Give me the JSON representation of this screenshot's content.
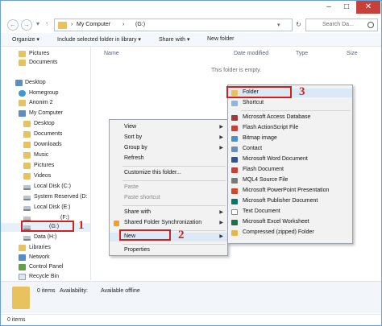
{
  "address": {
    "segments": [
      "My Computer",
      "(G:)"
    ],
    "search_placeholder": "Search Da..."
  },
  "title_controls": {
    "minimize": "–",
    "maximize": "□",
    "close": "✕"
  },
  "nav": {
    "back": "←",
    "forward": "→",
    "up": "↑",
    "recent": "▾",
    "refresh": "↻"
  },
  "toolbar": {
    "organize": "Organize ▾",
    "include": "Include selected folder in library ▾",
    "share": "Share with ▾",
    "new_folder": "New folder"
  },
  "sidebar": {
    "favorites": [
      {
        "label": "Pictures",
        "icon": "folder-icon"
      },
      {
        "label": "Documents",
        "icon": "folder-icon"
      }
    ],
    "desktop": "Desktop",
    "tree": [
      {
        "label": "Homegroup",
        "icon": "homegroup-icon"
      },
      {
        "label": "Anonim 2",
        "icon": "user-icon"
      },
      {
        "label": "My Computer",
        "icon": "computer-icon"
      },
      {
        "label": "Desktop",
        "icon": "folder-icon"
      },
      {
        "label": "Documents",
        "icon": "folder-icon"
      },
      {
        "label": "Downloads",
        "icon": "folder-icon"
      },
      {
        "label": "Music",
        "icon": "folder-icon"
      },
      {
        "label": "Pictures",
        "icon": "folder-icon"
      },
      {
        "label": "Videos",
        "icon": "folder-icon"
      },
      {
        "label": "Local Disk (C:)",
        "icon": "drive-icon"
      },
      {
        "label": "System Reserved (D:",
        "icon": "drive-icon"
      },
      {
        "label": "Local Disk (E:)",
        "icon": "drive-icon"
      },
      {
        "label": "(F:)",
        "icon": "drive-icon"
      },
      {
        "label": "(G:)",
        "icon": "drive-icon"
      },
      {
        "label": "Data (H:)",
        "icon": "drive-icon"
      },
      {
        "label": "Libraries",
        "icon": "folder-icon"
      },
      {
        "label": "Network",
        "icon": "network-icon"
      },
      {
        "label": "Control Panel",
        "icon": "control-panel-icon"
      },
      {
        "label": "Recycle Bin",
        "icon": "recycle-bin-icon"
      }
    ]
  },
  "columns": {
    "name": "Name",
    "date": "Date modified",
    "type": "Type",
    "size": "Size"
  },
  "empty_message": "This folder is empty.",
  "context_menu": {
    "items": [
      {
        "label": "View",
        "arrow": "▶"
      },
      {
        "label": "Sort by",
        "arrow": "▶"
      },
      {
        "label": "Group by",
        "arrow": "▶"
      },
      {
        "label": "Refresh",
        "arrow": ""
      },
      {
        "label": "Customize this folder...",
        "arrow": ""
      },
      {
        "label": "Paste",
        "arrow": ""
      },
      {
        "label": "Paste shortcut",
        "arrow": ""
      },
      {
        "label": "Share with",
        "arrow": "▶"
      },
      {
        "label": "Shared Folder Synchronization",
        "arrow": "▶"
      },
      {
        "label": "New",
        "arrow": "▶"
      },
      {
        "label": "Properties",
        "arrow": ""
      }
    ]
  },
  "new_submenu": {
    "items": [
      {
        "label": "Folder",
        "icon": "folder-icon",
        "color": "#e8c25d"
      },
      {
        "label": "Shortcut",
        "icon": "shortcut-icon",
        "color": "#8fb6dd"
      },
      {
        "label": "Microsoft Access Database",
        "icon": "access-icon",
        "color": "#a4373a"
      },
      {
        "label": "Flash ActionScript File",
        "icon": "flash-icon",
        "color": "#c8403a"
      },
      {
        "label": "Bitmap image",
        "icon": "bitmap-icon",
        "color": "#4a90c9"
      },
      {
        "label": "Contact",
        "icon": "contact-icon",
        "color": "#6b8fb3"
      },
      {
        "label": "Microsoft Word Document",
        "icon": "word-icon",
        "color": "#2b5797"
      },
      {
        "label": "Flash Document",
        "icon": "flash-doc-icon",
        "color": "#c8403a"
      },
      {
        "label": "MQL4 Source File",
        "icon": "mql4-icon",
        "color": "#7a7a7a"
      },
      {
        "label": "Microsoft PowerPoint Presentation",
        "icon": "powerpoint-icon",
        "color": "#d24726"
      },
      {
        "label": "Microsoft Publisher Document",
        "icon": "publisher-icon",
        "color": "#077568"
      },
      {
        "label": "Text Document",
        "icon": "text-icon",
        "color": "#ffffff"
      },
      {
        "label": "Microsoft Excel Worksheet",
        "icon": "excel-icon",
        "color": "#1e7145"
      },
      {
        "label": "Compressed (zipped) Folder",
        "icon": "zip-icon",
        "color": "#e0b84e"
      }
    ]
  },
  "status": {
    "items": "0 items",
    "availability_label": "Availability:",
    "availability_value": "Available offline"
  },
  "footer": {
    "count": "0 items"
  },
  "annotations": [
    "1",
    "2",
    "3"
  ],
  "colors": {
    "accent": "#d22020",
    "selection": "#dbe9f7"
  }
}
